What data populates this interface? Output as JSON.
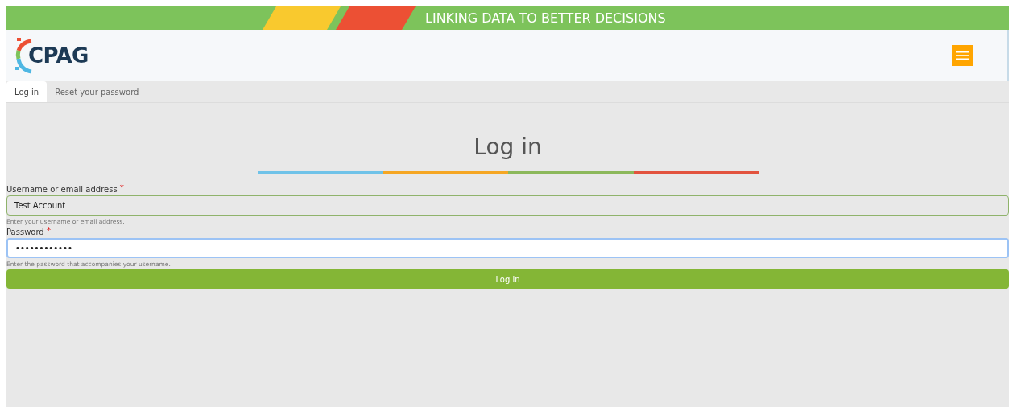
{
  "banner": {
    "tagline": "LINKING DATA TO BETTER DECISIONS"
  },
  "header": {
    "logo_text": "CPAG"
  },
  "tabs": [
    {
      "label": "Log in",
      "selected": true
    },
    {
      "label": "Reset your password",
      "selected": false
    }
  ],
  "heading": "Log in",
  "fields": [
    {
      "label": "Username or email address",
      "required_mark": "*",
      "value": "Test Account",
      "description": "Enter your username or email address.",
      "focused": false
    },
    {
      "label": "Password",
      "required_mark": "*",
      "value": "••••••••••••",
      "description": "Enter the password that accompanies your username.",
      "focused": true
    }
  ],
  "submit": "Log in"
}
